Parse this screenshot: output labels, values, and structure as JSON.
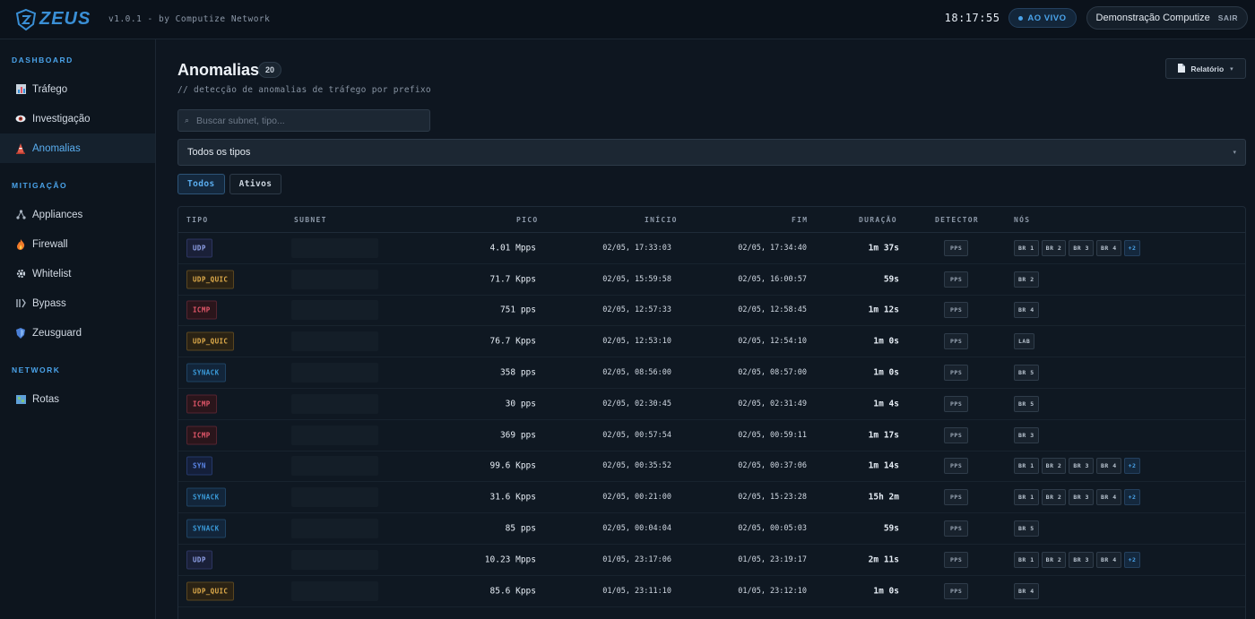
{
  "app": {
    "logo_text": "ZEUS",
    "version": "v1.0.1 - by Computize Network",
    "clock": "18:17:55",
    "live_label": "AO VIVO",
    "user_name": "Demonstração Computize",
    "logout_label": "SAIR",
    "accent_color": "#4aa3ea"
  },
  "sidebar": {
    "sections": [
      {
        "title": "DASHBOARD",
        "items": [
          {
            "label": "Tráfego",
            "icon": "chart-icon",
            "active": false
          },
          {
            "label": "Investigação",
            "icon": "eye-icon",
            "active": false
          },
          {
            "label": "Anomalias",
            "icon": "alert-cone-icon",
            "active": true
          }
        ]
      },
      {
        "title": "MITIGAÇÃO",
        "items": [
          {
            "label": "Appliances",
            "icon": "nodes-icon",
            "active": false
          },
          {
            "label": "Firewall",
            "icon": "fire-icon",
            "active": false
          },
          {
            "label": "Whitelist",
            "icon": "gear-icon",
            "active": false
          },
          {
            "label": "Bypass",
            "icon": "bypass-icon",
            "active": false
          },
          {
            "label": "Zeusguard",
            "icon": "shield-icon",
            "active": false
          }
        ]
      },
      {
        "title": "NETWORK",
        "items": [
          {
            "label": "Rotas",
            "icon": "map-icon",
            "active": false
          }
        ]
      }
    ]
  },
  "page": {
    "title": "Anomalias",
    "count": "20",
    "subtitle": "// detecção de anomalias de tráfego por prefixo",
    "report_label": "Relatório",
    "search_placeholder": "Buscar subnet, tipo...",
    "type_filter_value": "Todos os tipos",
    "filters": [
      "Todos",
      "Ativos"
    ],
    "active_filter": "Todos"
  },
  "table": {
    "headers": {
      "tipo": "TIPO",
      "subnet": "SUBNET",
      "pico": "PICO",
      "inicio": "INÍCIO",
      "fim": "FIM",
      "duracao": "DURAÇÃO",
      "detector": "DETECTOR",
      "nos": "NÓS"
    },
    "rows": [
      {
        "type": "UDP",
        "cls": "t-udp",
        "peak": "4.01 Mpps",
        "start": "02/05, 17:33:03",
        "end": "02/05, 17:34:40",
        "duration": "1m 37s",
        "detector": "PPS",
        "nodes": [
          "BR 1",
          "BR 2",
          "BR 3",
          "BR 4",
          "+2"
        ]
      },
      {
        "type": "UDP_QUIC",
        "cls": "t-udp_quic",
        "peak": "71.7 Kpps",
        "start": "02/05, 15:59:58",
        "end": "02/05, 16:00:57",
        "duration": "59s",
        "detector": "PPS",
        "nodes": [
          "BR 2"
        ]
      },
      {
        "type": "ICMP",
        "cls": "t-icmp",
        "peak": "751 pps",
        "start": "02/05, 12:57:33",
        "end": "02/05, 12:58:45",
        "duration": "1m 12s",
        "detector": "PPS",
        "nodes": [
          "BR 4"
        ]
      },
      {
        "type": "UDP_QUIC",
        "cls": "t-udp_quic",
        "peak": "76.7 Kpps",
        "start": "02/05, 12:53:10",
        "end": "02/05, 12:54:10",
        "duration": "1m 0s",
        "detector": "PPS",
        "nodes": [
          "LAB"
        ]
      },
      {
        "type": "SYNACK",
        "cls": "t-synack",
        "peak": "358 pps",
        "start": "02/05, 08:56:00",
        "end": "02/05, 08:57:00",
        "duration": "1m 0s",
        "detector": "PPS",
        "nodes": [
          "BR 5"
        ]
      },
      {
        "type": "ICMP",
        "cls": "t-icmp",
        "peak": "30 pps",
        "start": "02/05, 02:30:45",
        "end": "02/05, 02:31:49",
        "duration": "1m 4s",
        "detector": "PPS",
        "nodes": [
          "BR 5"
        ]
      },
      {
        "type": "ICMP",
        "cls": "t-icmp",
        "peak": "369 pps",
        "start": "02/05, 00:57:54",
        "end": "02/05, 00:59:11",
        "duration": "1m 17s",
        "detector": "PPS",
        "nodes": [
          "BR 3"
        ]
      },
      {
        "type": "SYN",
        "cls": "t-syn",
        "peak": "99.6 Kpps",
        "start": "02/05, 00:35:52",
        "end": "02/05, 00:37:06",
        "duration": "1m 14s",
        "detector": "PPS",
        "nodes": [
          "BR 1",
          "BR 2",
          "BR 3",
          "BR 4",
          "+2"
        ]
      },
      {
        "type": "SYNACK",
        "cls": "t-synack",
        "peak": "31.6 Kpps",
        "start": "02/05, 00:21:00",
        "end": "02/05, 15:23:28",
        "duration": "15h 2m",
        "detector": "PPS",
        "nodes": [
          "BR 1",
          "BR 2",
          "BR 3",
          "BR 4",
          "+2"
        ]
      },
      {
        "type": "SYNACK",
        "cls": "t-synack",
        "peak": "85 pps",
        "start": "02/05, 00:04:04",
        "end": "02/05, 00:05:03",
        "duration": "59s",
        "detector": "PPS",
        "nodes": [
          "BR 5"
        ]
      },
      {
        "type": "UDP",
        "cls": "t-udp",
        "peak": "10.23 Mpps",
        "start": "01/05, 23:17:06",
        "end": "01/05, 23:19:17",
        "duration": "2m 11s",
        "detector": "PPS",
        "nodes": [
          "BR 1",
          "BR 2",
          "BR 3",
          "BR 4",
          "+2"
        ]
      },
      {
        "type": "UDP_QUIC",
        "cls": "t-udp_quic",
        "peak": "85.6 Kpps",
        "start": "01/05, 23:11:10",
        "end": "01/05, 23:12:10",
        "duration": "1m 0s",
        "detector": "PPS",
        "nodes": [
          "BR 4"
        ]
      }
    ]
  }
}
